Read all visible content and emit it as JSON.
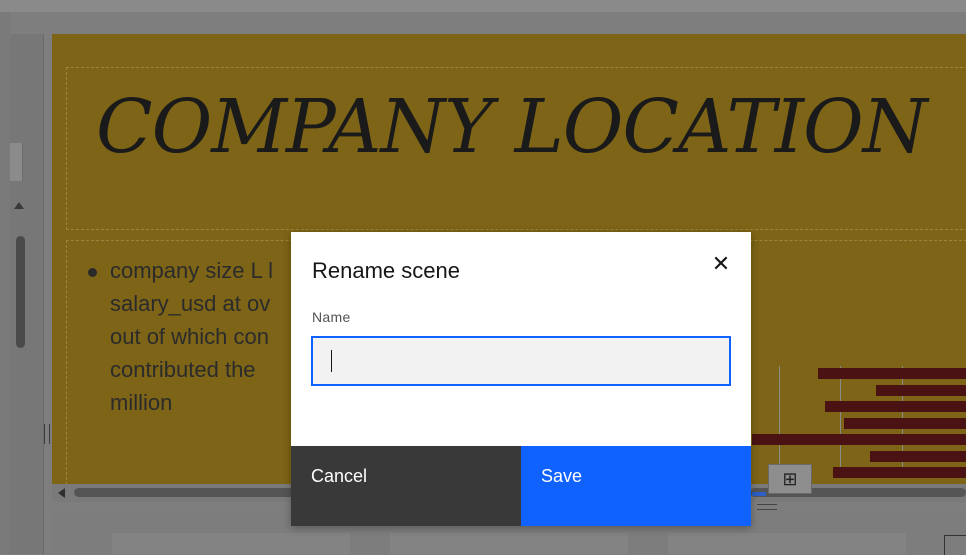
{
  "slide": {
    "title": "COMPANY LOCATION",
    "bullet_lines": [
      "company size L l",
      "salary_usd at ov",
      "out of which con",
      "contributed the",
      "million"
    ]
  },
  "chart_data": {
    "type": "bar",
    "orientation": "horizontal",
    "values_relative": [
      0.69,
      0.42,
      0.66,
      0.57,
      1.0,
      0.45,
      0.62
    ],
    "color": "#4a1212"
  },
  "toolbar": {
    "table_icon": "⊞"
  },
  "dialog": {
    "title": "Rename scene",
    "close_icon": "✕",
    "name_label": "Name",
    "name_value": "",
    "name_placeholder": "",
    "cancel_label": "Cancel",
    "save_label": "Save"
  },
  "colors": {
    "primary": "#0f62fe",
    "secondary_button": "#393939",
    "slide_background": "#7d6416"
  }
}
